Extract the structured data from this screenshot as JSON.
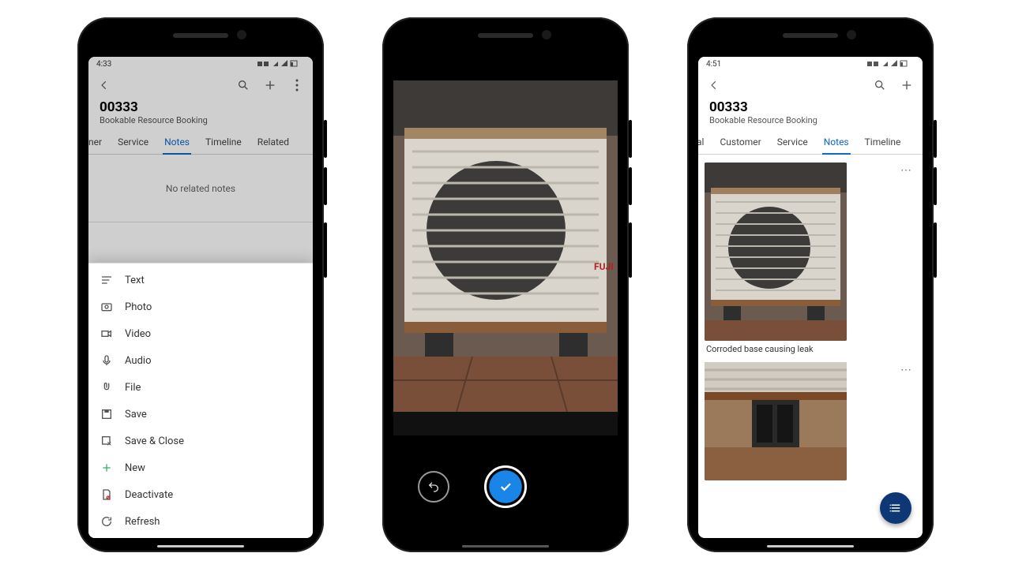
{
  "statusbar": {
    "time_a": "4:33",
    "time_c": "4:51"
  },
  "record": {
    "id": "00333",
    "entity": "Bookable Resource Booking"
  },
  "tabs_a": {
    "items": [
      "ner",
      "Service",
      "Notes",
      "Timeline",
      "Related"
    ],
    "active": 2
  },
  "tabs_c": {
    "items": [
      "al",
      "Customer",
      "Service",
      "Notes",
      "Timeline"
    ],
    "active": 3
  },
  "empty_notes": "No related notes",
  "sheet_items": [
    {
      "icon": "text-icon",
      "label": "Text"
    },
    {
      "icon": "photo-icon",
      "label": "Photo"
    },
    {
      "icon": "video-icon",
      "label": "Video"
    },
    {
      "icon": "audio-icon",
      "label": "Audio"
    },
    {
      "icon": "file-icon",
      "label": "File"
    },
    {
      "icon": "save-icon",
      "label": "Save"
    },
    {
      "icon": "save-close-icon",
      "label": "Save & Close"
    },
    {
      "icon": "new-icon",
      "label": "New"
    },
    {
      "icon": "deactivate-icon",
      "label": "Deactivate"
    },
    {
      "icon": "refresh-icon",
      "label": "Refresh"
    }
  ],
  "note_items": [
    {
      "caption": "Corroded base causing leak"
    },
    {
      "caption": ""
    }
  ]
}
